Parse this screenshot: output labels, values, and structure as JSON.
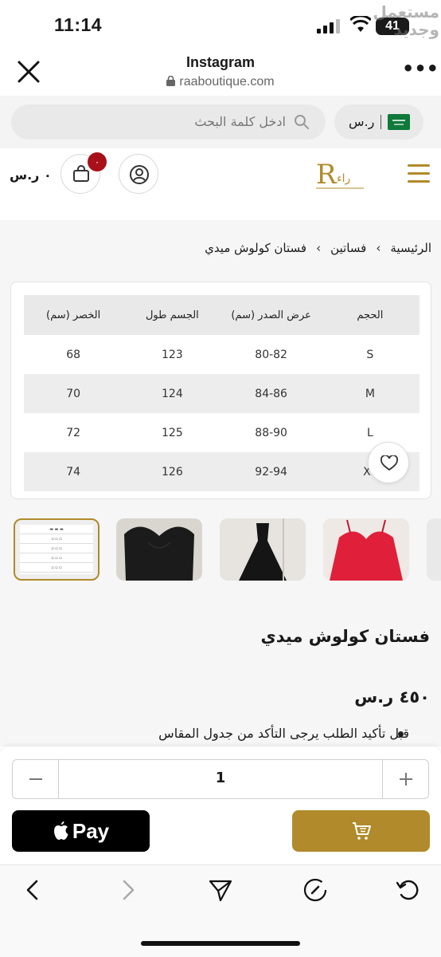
{
  "status_bar": {
    "time": "11:14",
    "battery": "41"
  },
  "watermark": "مستعمل وجديد",
  "browser": {
    "title": "Instagram",
    "url": "raaboutique.com"
  },
  "search": {
    "placeholder": "ادخل كلمة البحث"
  },
  "currency": {
    "label": "ر.س"
  },
  "nav": {
    "cart_total": "٠ ر.س",
    "cart_count": "٠",
    "logo_text": "Raa"
  },
  "breadcrumb": {
    "home": "الرئيسية",
    "category": "فساتين",
    "current": "فستان كولوش ميدي",
    "separator": "›"
  },
  "size_table": {
    "headers": [
      "الحجم",
      "عرض الصدر (سم)",
      "الجسم طول",
      "الخصر (سم)"
    ],
    "rows": [
      [
        "S",
        "80-82",
        "123",
        "68"
      ],
      [
        "M",
        "84-86",
        "124",
        "70"
      ],
      [
        "L",
        "88-90",
        "125",
        "72"
      ],
      [
        "XL",
        "92-94",
        "126",
        "74"
      ]
    ]
  },
  "product": {
    "title": "فستان كولوش ميدي",
    "price": "٤٥٠ ر.س",
    "note": "قبل تأكيد الطلب يرجى التأكد من جدول المقاس"
  },
  "purchase": {
    "quantity": "1",
    "minus": "−",
    "plus": "+",
    "apple_pay": "Pay"
  },
  "colors": {
    "accent": "#b08a2b",
    "badge": "#a8101a",
    "flag": "#0f7a3a"
  },
  "icons": [
    "close-icon",
    "more-icon",
    "lock-icon",
    "search-icon",
    "saudi-flag-icon",
    "cart-icon",
    "user-icon",
    "menu-icon",
    "heart-icon",
    "apple-icon",
    "back-icon",
    "forward-icon",
    "share-icon",
    "compass-icon",
    "reload-icon"
  ]
}
